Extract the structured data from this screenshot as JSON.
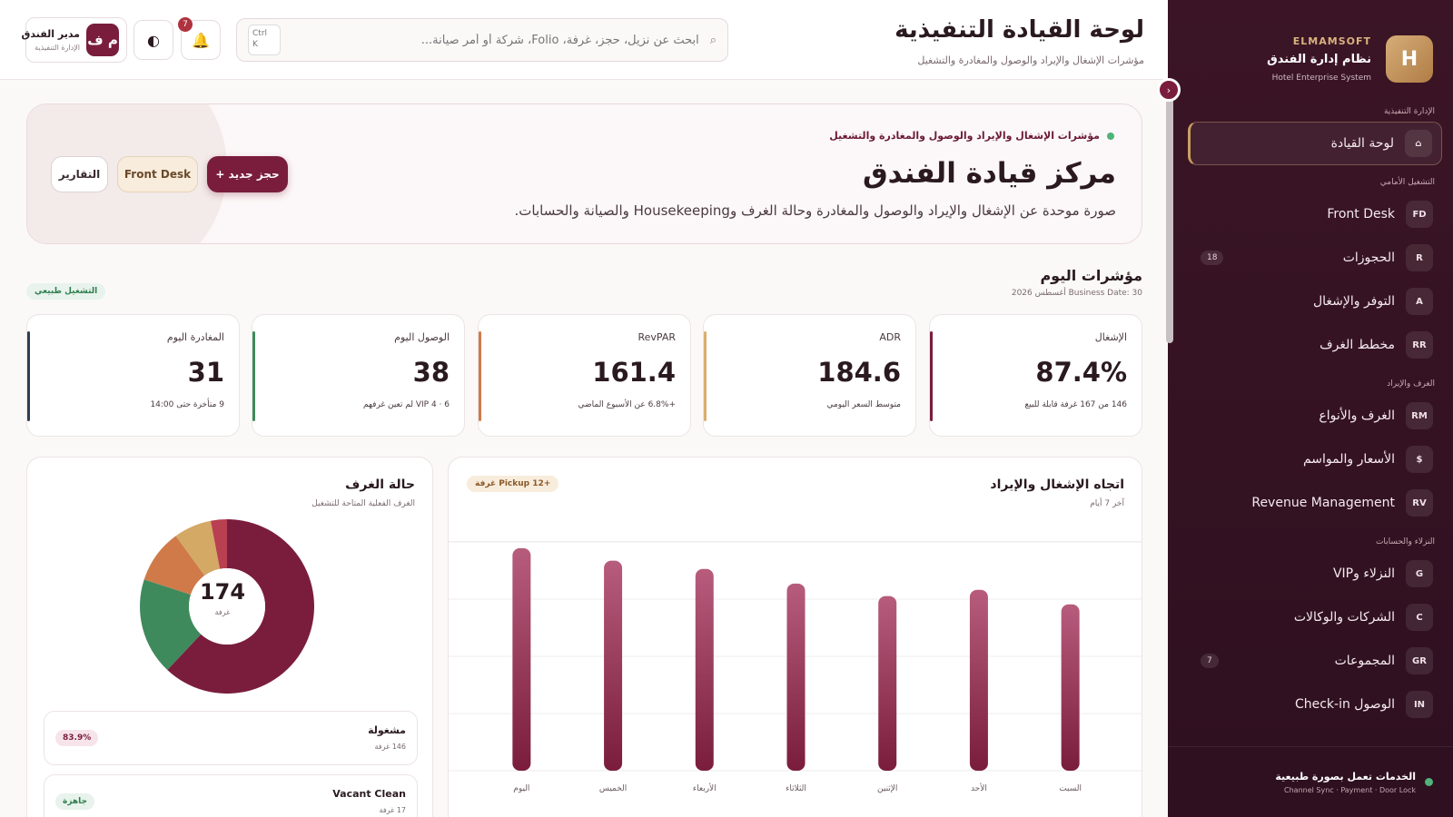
{
  "sidebar": {
    "brand_small": "ELMAMSOFT",
    "brand_title": "نظام إدارة الفندق",
    "brand_sub": "Hotel Enterprise System",
    "brand_logo": "H",
    "sections": {
      "exec": "الإدارة التنفيذية",
      "front": "التشغيل الأمامي",
      "rooms": "الغرف والإيراد",
      "guests": "النزلاء والحسابات"
    },
    "items": [
      {
        "code": "⌂",
        "label": "لوحة القيادة",
        "badge": ""
      },
      {
        "code": "FD",
        "label": "Front Desk",
        "badge": ""
      },
      {
        "code": "R",
        "label": "الحجوزات",
        "badge": "18"
      },
      {
        "code": "A",
        "label": "التوفر والإشغال",
        "badge": ""
      },
      {
        "code": "RR",
        "label": "مخطط الغرف",
        "badge": ""
      },
      {
        "code": "RM",
        "label": "الغرف والأنواع",
        "badge": ""
      },
      {
        "code": "$",
        "label": "الأسعار والمواسم",
        "badge": ""
      },
      {
        "code": "RV",
        "label": "Revenue Management",
        "badge": ""
      },
      {
        "code": "G",
        "label": "النزلاء وVIP",
        "badge": ""
      },
      {
        "code": "C",
        "label": "الشركات والوكالات",
        "badge": ""
      },
      {
        "code": "GR",
        "label": "المجموعات",
        "badge": "7"
      },
      {
        "code": "IN",
        "label": "الوصول Check-in",
        "badge": ""
      }
    ],
    "footer_main": "الخدمات تعمل بصورة طبيعية",
    "footer_sub": "Channel Sync · Payment · Door Lock"
  },
  "header": {
    "title": "لوحة القيادة التنفيذية",
    "subtitle": "مؤشرات الإشغال والإيراد والوصول والمغادرة والتشغيل",
    "search_placeholder": "ابحث عن نزيل، حجز، غرفة، Folio، شركة أو أمر صيانة...",
    "kbd_line1": "Ctrl",
    "kbd_line2": "K",
    "notifications": "7",
    "user_initials": "م ف",
    "user_name": "مدير الفندق",
    "user_role": "الإدارة التنفيذية"
  },
  "hero": {
    "tag": "مؤشرات الإشغال والإيراد والوصول والمغادرة والتشغيل",
    "title": "مركز قيادة الفندق",
    "description": "صورة موحدة عن الإشغال والإيراد والوصول والمغادرة وحالة الغرف وHousekeeping والصيانة والحسابات.",
    "new_booking": "+ حجز جديد",
    "front_desk": "Front Desk",
    "reports": "التقارير"
  },
  "today": {
    "title": "مؤشرات اليوم",
    "business_date": "Business Date: 30 أغسطس 2026",
    "status": "التشغيل طبيعي"
  },
  "kpis": [
    {
      "label": "الإشغال",
      "value": "87.4%",
      "note": "146 من 167 غرفة قابلة للبيع",
      "color": "#7a1d3d"
    },
    {
      "label": "ADR",
      "value": "184.6",
      "note": "متوسط السعر اليومي",
      "color": "#d8b070"
    },
    {
      "label": "RevPAR",
      "value": "161.4",
      "note": "+6.8% عن الأسبوع الماضي",
      "color": "#d07a4a"
    },
    {
      "label": "الوصول اليوم",
      "value": "38",
      "note": "VIP 4 · 6 لم تعين غرفهم",
      "color": "#3e8a5c"
    },
    {
      "label": "المغادرة اليوم",
      "value": "31",
      "note": "9 متأخرة حتى 14:00",
      "color": "#2d3e55"
    }
  ],
  "trend": {
    "title": "اتجاه الإشغال والإيراد",
    "subtitle": "آخر 7 أيام",
    "pickup": "+12 Pickup غرفة"
  },
  "room_status": {
    "title": "حالة الغرف",
    "subtitle": "الغرف الفعلية المتاحة للتشغيل",
    "total": "174",
    "unit": "غرفة",
    "legend": [
      {
        "name": "مشغولة",
        "count": "146 غرفة",
        "pct": "83.9%"
      },
      {
        "name": "Vacant Clean",
        "count": "17 غرفة",
        "pct": "جاهزة"
      }
    ]
  },
  "chart_data": [
    {
      "type": "bar",
      "categories": [
        "السبت",
        "الأحد",
        "الإثنين",
        "الثلاثاء",
        "الأربعاء",
        "الخميس",
        "اليوم"
      ],
      "values": [
        80,
        87,
        84,
        90,
        97,
        101,
        107
      ],
      "ylim": [
        0,
        110
      ],
      "grid": true,
      "colors": {
        "bar_top": "#b75c7c",
        "bar_bottom": "#7a1d3d"
      }
    },
    {
      "type": "pie",
      "labels": [
        "",
        "",
        "",
        "",
        ""
      ],
      "values": [
        62,
        18,
        10,
        7,
        3
      ],
      "colors": [
        "#7a1d3d",
        "#3e8a5c",
        "#d07a4a",
        "#d4a865",
        "#b84050"
      ]
    }
  ]
}
